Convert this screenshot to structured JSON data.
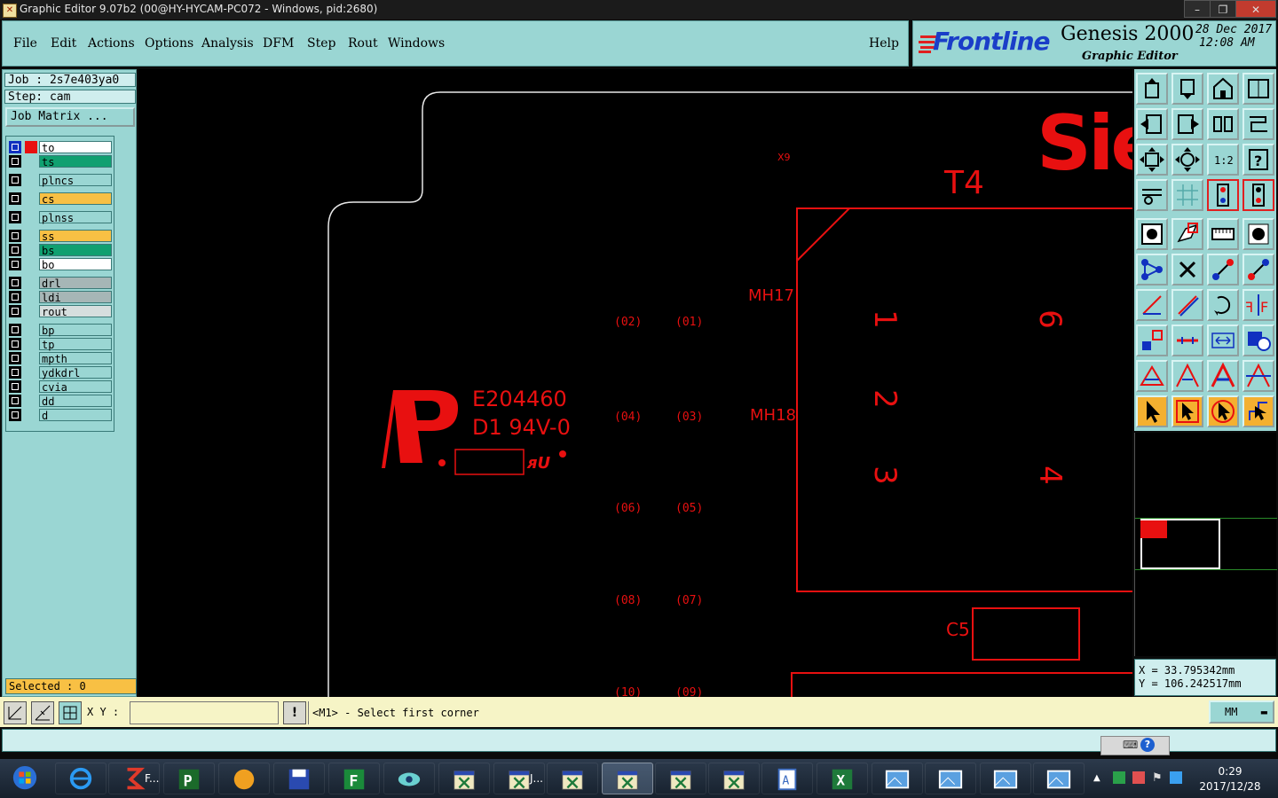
{
  "window": {
    "title": "Graphic Editor 9.07b2 (00@HY-HYCAM-PC072 - Windows, pid:2680)",
    "controls": {
      "minimize": "–",
      "maximize": "❐",
      "close": "✕"
    }
  },
  "menu": {
    "items": [
      "File",
      "Edit",
      "Actions",
      "Options",
      "Analysis",
      "DFM",
      "Step",
      "Rout",
      "Windows"
    ],
    "help": "Help"
  },
  "brand": {
    "logo": "Frontline",
    "product": "Genesis 2000",
    "subtitle": "Graphic Editor",
    "date": "28 Dec 2017",
    "time": "12:08 AM"
  },
  "job": {
    "job_label": "Job : 2s7e403ya0",
    "step_label": "Step: cam",
    "matrix_button": "Job Matrix ..."
  },
  "layers": [
    {
      "name": "to",
      "color": "#ffffff",
      "active": true
    },
    {
      "name": "ts",
      "color": "#10a070"
    },
    {
      "name": "plncs",
      "color": "#9ad6d3"
    },
    {
      "name": "cs",
      "color": "#f8c044"
    },
    {
      "name": "plnss",
      "color": "#9ad6d3"
    },
    {
      "name": "ss",
      "color": "#f8c044"
    },
    {
      "name": "bs",
      "color": "#10a070"
    },
    {
      "name": "bo",
      "color": "#ffffff"
    },
    {
      "name": "drl",
      "color": "#a6b6b6"
    },
    {
      "name": "ldi",
      "color": "#a6b6b6"
    },
    {
      "name": "rout",
      "color": "#d6dede"
    },
    {
      "name": "bp",
      "color": "#9ad6d3"
    },
    {
      "name": "tp",
      "color": "#9ad6d3"
    },
    {
      "name": "mpth",
      "color": "#9ad6d3"
    },
    {
      "name": "ydkdrl",
      "color": "#9ad6d3"
    },
    {
      "name": "cvia",
      "color": "#9ad6d3"
    },
    {
      "name": "dd",
      "color": "#9ad6d3"
    },
    {
      "name": "d",
      "color": "#9ad6d3"
    }
  ],
  "selected": "Selected : 0",
  "canvas": {
    "logo_text_1": "E204460",
    "logo_text_2": "D1 94V-0",
    "logo_letter": "P",
    "mh17": "MH17",
    "mh18": "MH18",
    "t4": "T4",
    "c5": "C5",
    "x9": "X9",
    "sie": "Sie",
    "pins": [
      "1",
      "2",
      "3",
      "4",
      "6"
    ],
    "pads": [
      "(02)",
      "(01)",
      "(04)",
      "(03)",
      "(06)",
      "(05)",
      "(08)",
      "(07)",
      "(10)",
      "(09)"
    ],
    "colors": {
      "copper": "#e81010",
      "outline": "#e0e0e0"
    }
  },
  "tools": [
    "go-up-icon",
    "go-down-icon",
    "home-icon",
    "window-icon",
    "exit-left-icon",
    "exit-right-icon",
    "mirror-icon",
    "step-icon",
    "zoom-fit-icon",
    "zoom-center-icon",
    "scale-1-2-icon",
    "help-icon",
    "measure-icon",
    "grid-icon",
    "snap-icon",
    "snap-alt-icon",
    "pad-select-icon",
    "polygon-icon",
    "ruler-icon",
    "dot-icon",
    "nodes-icon",
    "cross-icon",
    "line-node-icon",
    "line-node-alt-icon",
    "angle-icon",
    "slash-icon",
    "rotate-icon",
    "flip-icon",
    "move-node-icon",
    "minus-icon",
    "distance-icon",
    "dup-icon",
    "triangle-a-icon",
    "triangle-b-icon",
    "triangle-c-icon",
    "triangle-d-icon",
    "pointer-icon",
    "pointer-box-icon",
    "pointer-round-icon",
    "route-icon"
  ],
  "coords": {
    "x": "X = 33.795342mm",
    "y": "Y = 106.242517mm"
  },
  "command": {
    "xy_label": "X Y :",
    "xy_value": "",
    "warn": "!",
    "prompt": "<M1> - Select first corner",
    "units": "MM"
  },
  "taskbar": {
    "items": [
      "start",
      "ie",
      "foxit",
      "pcb",
      "shell",
      "save",
      "frontline",
      "eye",
      "x1",
      "x2",
      "x3",
      "x4",
      "x5",
      "x6",
      "word",
      "excel",
      "pic1",
      "pic2",
      "pic3",
      "pic4"
    ],
    "foxit_label": "F...",
    "x2_label": "J...",
    "clock_time": "0:29",
    "clock_date": "2017/12/28"
  }
}
